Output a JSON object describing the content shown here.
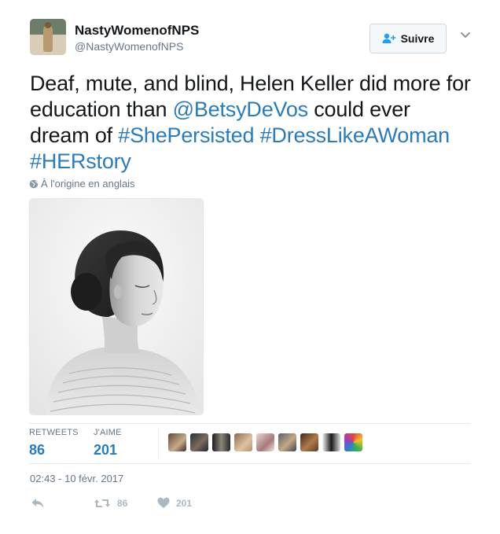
{
  "user": {
    "display_name": "NastyWomenofNPS",
    "handle": "@NastyWomenofNPS",
    "avatar_icon": "profile-photo"
  },
  "follow_button": {
    "label": "Suivre",
    "icon": "add-user-icon"
  },
  "menu": {
    "icon": "chevron-down-icon"
  },
  "tweet": {
    "part1": "Deaf, mute, and blind, Helen Keller did more for education than ",
    "mention": "@BetsyDeVos",
    "part2": " could ever dream of ",
    "hashtag1": "#ShePersisted",
    "hashtag2": "#DressLikeAWoman",
    "hashtag3": "#HERstory"
  },
  "translate": {
    "label": "À l'origine en anglais",
    "icon": "globe-icon"
  },
  "media": {
    "type": "photo",
    "description_icon": "portrait-photo"
  },
  "stats": {
    "retweets_label": "RETWEETS",
    "retweets": "86",
    "likes_label": "J'AIME",
    "likes": "201"
  },
  "likers_count": 9,
  "timestamp": "02:43 - 10 févr. 2017",
  "actions": {
    "reply_icon": "reply-icon",
    "retweet_icon": "retweet-icon",
    "retweet_count": "86",
    "like_icon": "heart-icon",
    "like_count": "201"
  },
  "colors": {
    "link": "#2b7bb9",
    "secondary_text": "#657786",
    "action_gray": "#aab8c2",
    "border": "#e6ecf0"
  }
}
